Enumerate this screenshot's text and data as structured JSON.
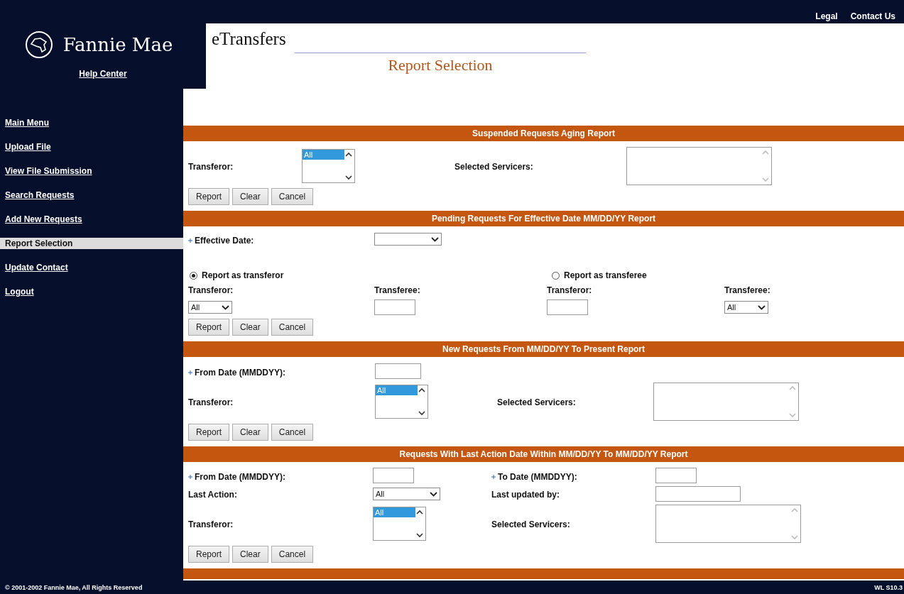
{
  "top_links": [
    "Legal",
    "Contact Us"
  ],
  "logo": {
    "name": "Fannie Mae",
    "link": "Help Center"
  },
  "app_title": "eTransfers",
  "page_title": "Report Selection",
  "sidebar": {
    "items": [
      {
        "label": "Main Menu",
        "selected": false
      },
      {
        "label": "Upload File",
        "selected": false
      },
      {
        "label": "View File Submission",
        "selected": false
      },
      {
        "label": "Search Requests",
        "selected": false
      },
      {
        "label": "Add New Requests",
        "selected": false
      },
      {
        "label": "Report Selection",
        "selected": true
      },
      {
        "label": "Update Contact",
        "selected": false
      },
      {
        "label": "Logout",
        "selected": false
      }
    ]
  },
  "sections": [
    {
      "kind": "aging",
      "title": "Suspended Requests Aging Report",
      "rows": [
        [
          {
            "kind": "label",
            "text": "Transferor:",
            "required": false
          },
          {
            "kind": "listbox",
            "options": [
              {
                "label": "All",
                "selected": true
              }
            ]
          },
          {
            "kind": "label",
            "text": "Selected Servicers:",
            "required": false
          },
          {
            "kind": "textarea"
          }
        ]
      ],
      "buttons": [
        "Report",
        "Clear",
        "Cancel"
      ]
    },
    {
      "kind": "pending",
      "title": "Pending Requests For Effective Date MM/DD/YY Report",
      "rows": [
        [
          {
            "kind": "label",
            "text": "Effective Date:",
            "required": true
          },
          {
            "kind": "select"
          }
        ],
        [
          {
            "kind": "radio",
            "label": "Report as transferor",
            "selected": true
          },
          "",
          {
            "kind": "radio",
            "label": "Report as transferee",
            "selected": false
          }
        ],
        [
          {
            "kind": "label",
            "text": "Transferor:",
            "required": false
          },
          {
            "kind": "label",
            "text": "Transferee:",
            "required": false
          },
          {
            "kind": "label",
            "text": "Transferor:",
            "required": false
          },
          {
            "kind": "label",
            "text": "Transferee:",
            "required": false
          }
        ],
        [
          {
            "kind": "select",
            "value": "All"
          },
          {
            "kind": "text_input"
          },
          {
            "kind": "text_input"
          },
          {
            "kind": "select",
            "value": "All"
          }
        ]
      ],
      "buttons": [
        "Report",
        "Clear",
        "Cancel"
      ]
    },
    {
      "kind": "new",
      "title": "New Requests From MM/DD/YY To Present Report",
      "rows": [
        [
          {
            "kind": "label",
            "text": "From Date (MMDDYY):",
            "required": true
          },
          {
            "kind": "text_input"
          }
        ],
        [
          {
            "kind": "label",
            "text": "Transferor:",
            "required": false
          },
          {
            "kind": "listbox",
            "options": [
              {
                "label": "All",
                "selected": true
              }
            ]
          },
          {
            "kind": "label",
            "text": "Selected Servicers:",
            "required": false
          },
          {
            "kind": "textarea"
          }
        ]
      ],
      "buttons": [
        "Report",
        "Clear",
        "Cancel"
      ]
    },
    {
      "kind": "last_action",
      "title": "Requests With Last Action Date Within MM/DD/YY To MM/DD/YY Report",
      "rows": [
        [
          {
            "kind": "label",
            "text": "From Date (MMDDYY):",
            "required": true
          },
          {
            "kind": "text_input"
          },
          {
            "kind": "label",
            "text": "To Date (MMDDYY):",
            "required": true
          },
          {
            "kind": "text_input"
          }
        ],
        [
          {
            "kind": "label",
            "text": "Last Action:",
            "required": false
          },
          {
            "kind": "select",
            "value": "All"
          },
          {
            "kind": "label",
            "text": "Last updated by:",
            "required": false
          },
          {
            "kind": "wide_input"
          }
        ],
        [
          {
            "kind": "label",
            "text": "Transferor:",
            "required": false
          },
          {
            "kind": "listbox",
            "options": [
              {
                "label": "All",
                "selected": true
              }
            ]
          },
          {
            "kind": "label",
            "text": "Selected Servicers:",
            "required": false
          },
          {
            "kind": "textarea"
          }
        ]
      ],
      "buttons": [
        "Report",
        "Clear",
        "Cancel"
      ]
    }
  ],
  "footer": {
    "copyright": "© 2001-2002 Fannie Mae, All Rights Reserved",
    "version": "WL S10.3"
  }
}
